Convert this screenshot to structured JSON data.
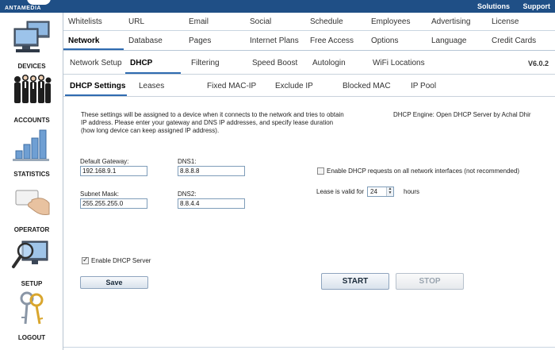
{
  "brand": "ANTAMEDIA",
  "top_links": [
    "Solutions",
    "Support"
  ],
  "sidebar": [
    {
      "label": "DEVICES",
      "icon": "computers-icon"
    },
    {
      "label": "ACCOUNTS",
      "icon": "people-icon"
    },
    {
      "label": "STATISTICS",
      "icon": "bar-chart-icon"
    },
    {
      "label": "OPERATOR",
      "icon": "hand-card-icon"
    },
    {
      "label": "SETUP",
      "icon": "magnifier-monitor-icon"
    },
    {
      "label": "LOGOUT",
      "icon": "keys-icon"
    }
  ],
  "tabs_row1": [
    "Whitelists",
    "URL",
    "Email",
    "Social",
    "Schedule",
    "Employees",
    "Advertising",
    "License"
  ],
  "tabs_row2": [
    "Network",
    "Database",
    "Pages",
    "Internet Plans",
    "Free Access",
    "Options",
    "Language",
    "Credit Cards"
  ],
  "tabs_row3": [
    "Network Setup",
    "DHCP",
    "Filtering",
    "Speed Boost",
    "Autologin",
    "WiFi Locations"
  ],
  "version": "V6.0.2",
  "tabs_row4": [
    "DHCP Settings",
    "Leases",
    "Fixed MAC-IP",
    "Exclude IP",
    "Blocked MAC",
    "IP Pool"
  ],
  "content": {
    "description": "These settings will be assigned to a device when it connects to the network and tries to obtain IP address. Please enter your gateway and DNS IP addresses, and specify lease duration (how long device can keep assigned IP address).",
    "engine": "DHCP Engine: Open DHCP Server by Achal Dhir",
    "gateway_label": "Default Gateway:",
    "gateway_value": "192.168.9.1",
    "dns1_label": "DNS1:",
    "dns1_value": "8.8.8.8",
    "subnet_label": "Subnet Mask:",
    "subnet_value": "255.255.255.0",
    "dns2_label": "DNS2:",
    "dns2_value": "8.8.4.4",
    "all_interfaces_label": "Enable DHCP requests on all network interfaces (not recommended)",
    "lease_label": "Lease is valid for",
    "lease_value": "24",
    "lease_unit": "hours",
    "enable_label": "Enable DHCP Server",
    "save": "Save",
    "start": "START",
    "stop": "STOP"
  }
}
